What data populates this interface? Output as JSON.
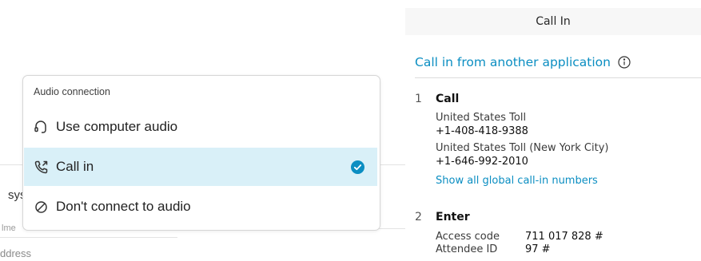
{
  "background": {
    "partial_text_1": "sys",
    "partial_text_2": "lme",
    "partial_text_3": "ddress"
  },
  "audio_connection": {
    "header": "Audio connection",
    "options": [
      {
        "label": "Use computer audio",
        "icon": "headset-icon",
        "selected": false
      },
      {
        "label": "Call in",
        "icon": "phone-outgoing-icon",
        "selected": true
      },
      {
        "label": "Don't connect to audio",
        "icon": "no-audio-icon",
        "selected": false
      }
    ],
    "selected_color": "#d9f0f8",
    "check_color": "#0b8ec2"
  },
  "call_in": {
    "title": "Call In",
    "other_app_link": "Call in from another application",
    "step1": {
      "number": "1",
      "title": "Call",
      "numbers": [
        {
          "label": "United States Toll",
          "value": "+1-408-418-9388"
        },
        {
          "label": "United States Toll (New York City)",
          "value": "+1-646-992-2010"
        }
      ],
      "global_link": "Show all global call-in numbers"
    },
    "step2": {
      "number": "2",
      "title": "Enter",
      "access_code_label": "Access code",
      "access_code_value": "711 017 828 #",
      "attendee_id_label": "Attendee ID",
      "attendee_id_value": "97 #"
    },
    "accent_color": "#0b8ec2"
  }
}
